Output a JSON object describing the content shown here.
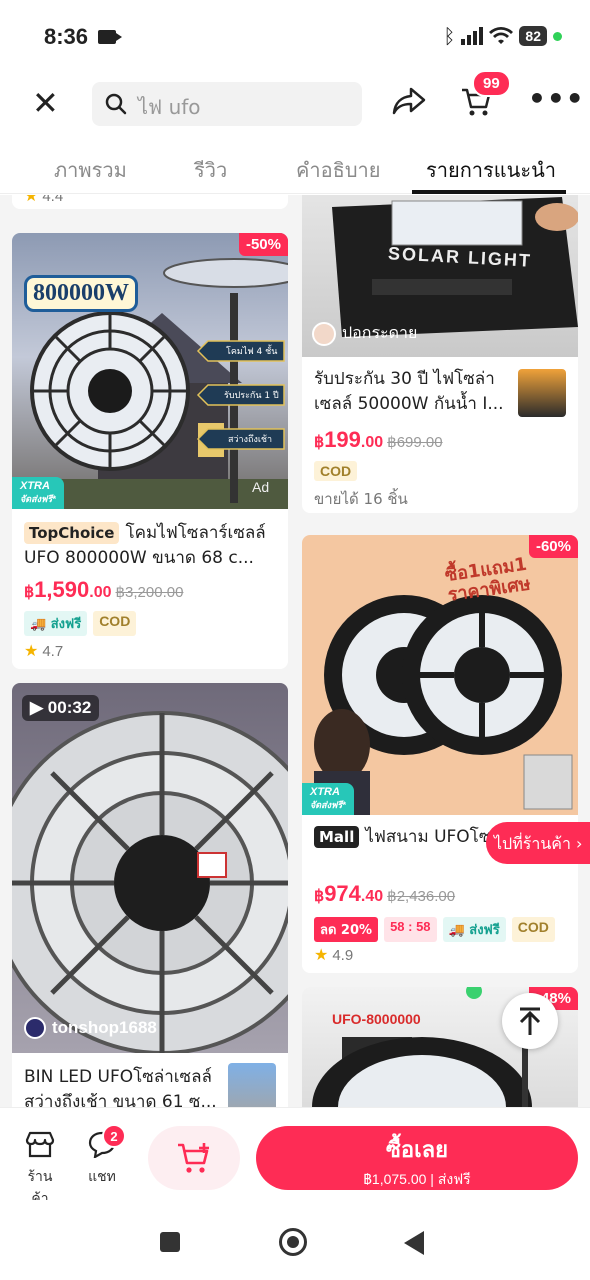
{
  "status_bar": {
    "time": "8:36",
    "battery": "82"
  },
  "header": {
    "search_placeholder": "ไฟ ufo",
    "cart_count": "99"
  },
  "tabs": [
    {
      "label": "ภาพรวม"
    },
    {
      "label": "รีวิว"
    },
    {
      "label": "คำอธิบาย"
    },
    {
      "label": "รายการแนะนำ",
      "active": true
    }
  ],
  "top_partial": {
    "rating": "4.4"
  },
  "products": [
    {
      "image_text": "800000W",
      "image_labels": [
        "โคมไฟ 4 ชั้น",
        "รับประกัน 1 ปี",
        "สว่างถึงเช้า"
      ],
      "image_badge": "Ad",
      "discount": "-50%",
      "xtra": "XTRA",
      "xtra_sub": "จัดส่งฟรี*",
      "tag": "TopChoice",
      "title": "โคมไฟโซลาร์เซลล์ UFO 800000W ขนาด 68 c...",
      "price_currency": "฿",
      "price_main": "1,590",
      "price_decimal": ".00",
      "old_price": "฿3,200.00",
      "badge_free": "ส่งฟรี",
      "badge_cod": "COD",
      "rating": "4.7"
    },
    {
      "image_text": "SOLAR LIGHT",
      "seller": "ปอกระดาย",
      "title": "รับประกัน 30 ปี ไฟโซล่าเซลล์ 50000W กันน้ำ I...",
      "price_currency": "฿",
      "price_main": "199",
      "price_decimal": ".00",
      "old_price": "฿699.00",
      "badge_cod": "COD",
      "sold": "ขายได้ 16 ชิ้น"
    },
    {
      "image_banner": "ซื้อ1แถม1 ราคาพิเศษ",
      "discount": "-60%",
      "xtra": "XTRA",
      "xtra_sub": "จัดส่งฟรี*",
      "tag": "Mall",
      "title": "ไฟสนาม UFOโซล่าเซลล์ 750LED สว่างยันเช้า รุ่น UFO...",
      "price_currency": "฿",
      "price_main": "974",
      "price_decimal": ".40",
      "old_price": "฿2,436.00",
      "badge_off": "ลด 20%",
      "badge_timer": "58 : 58",
      "badge_free": "ส่งฟรี",
      "badge_cod": "COD",
      "rating": "4.9"
    },
    {
      "video_duration": "00:32",
      "seller": "tonshop1688",
      "title": "BIN LED UFOโซล่าเซลล์ สว่างถึงเช้า ขนาด 61 ซ..."
    },
    {
      "image_banner": "UFO-8000000",
      "discount": "-48%"
    }
  ],
  "goto_store": "ไปที่ร้านค้า",
  "bottom_bar": {
    "store_label": "ร้านค้า",
    "chat_label": "แชท",
    "chat_badge": "2",
    "buy_label": "ซื้อเลย",
    "buy_price": "฿1,075.00",
    "buy_shipping": "ส่งฟรี"
  },
  "colors": {
    "accent": "#fe2c55",
    "teal": "#27c7b8"
  }
}
